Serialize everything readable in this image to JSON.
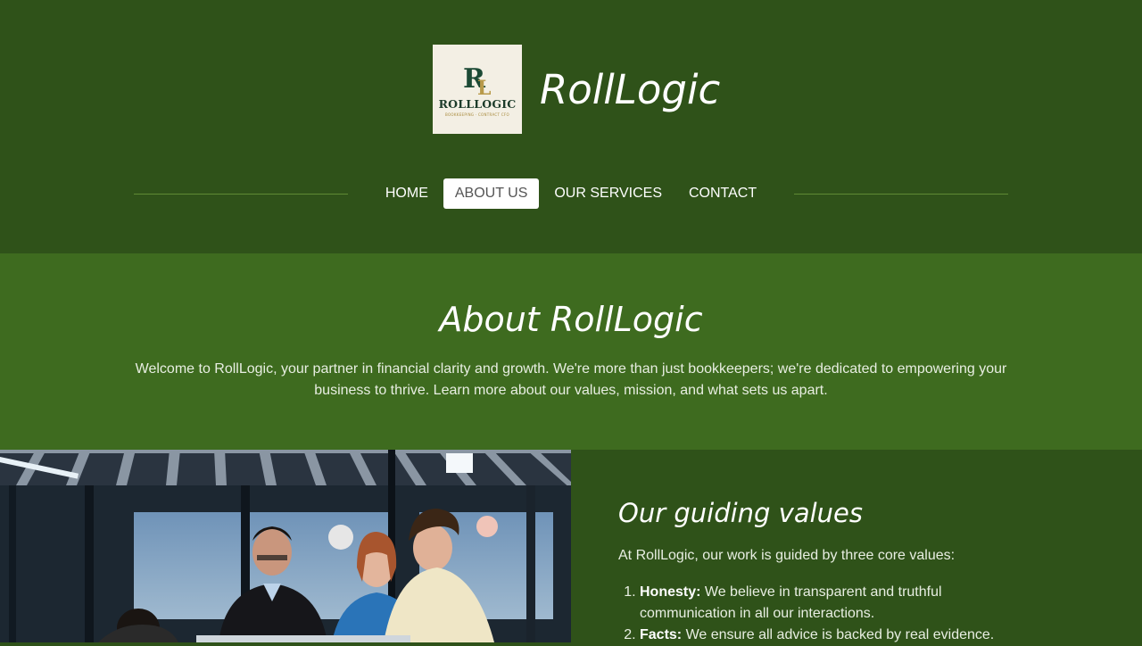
{
  "brand": {
    "logo_word": "ROLLLOGIC",
    "logo_tagline": "BOOKKEEPING · CONTRACT CFO",
    "site_title": "RollLogic"
  },
  "nav": {
    "items": [
      {
        "label": "HOME"
      },
      {
        "label": "ABOUT US",
        "active": true
      },
      {
        "label": "OUR SERVICES"
      },
      {
        "label": "CONTACT"
      }
    ]
  },
  "about": {
    "title": "About RollLogic",
    "body": "Welcome to RollLogic, your partner in financial clarity and growth. We're more than just bookkeepers; we're dedicated to empowering your business to thrive. Learn more about our values, mission, and what sets us apart."
  },
  "values": {
    "title": "Our guiding values",
    "intro": "At RollLogic, our work is guided by three core values:",
    "items": [
      {
        "term": "Honesty:",
        "text": " We believe in transparent and truthful communication in all our interactions."
      },
      {
        "term": "Facts:",
        "text": " We ensure all advice is backed by real evidence."
      }
    ]
  },
  "colors": {
    "header_bg": "#2f5219",
    "band_bg": "#3e6b1f",
    "logo_bg": "#f3efe4"
  }
}
